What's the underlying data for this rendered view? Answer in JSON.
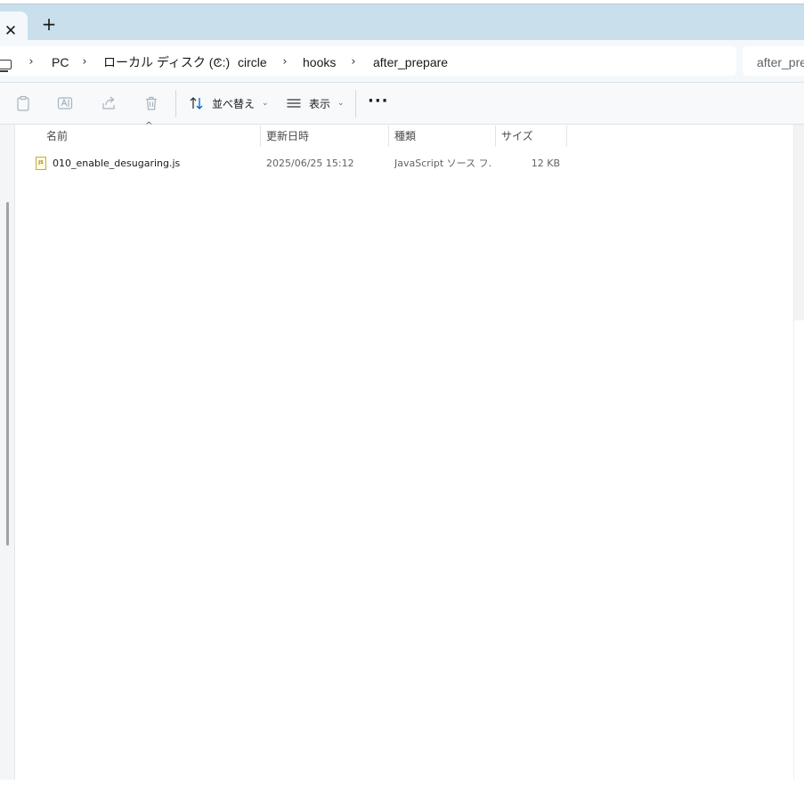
{
  "tabs": {
    "close_glyph": "✕",
    "new_tab_glyph": "+"
  },
  "breadcrumb": {
    "items": [
      "PC",
      "ローカル ディスク (C:)",
      "circle",
      "hooks",
      "after_prepare"
    ],
    "separator": "›"
  },
  "search": {
    "text": "after_pre"
  },
  "toolbar": {
    "sort_label": "並べ替え",
    "view_label": "表示",
    "more_glyph": "···"
  },
  "columns": {
    "name": "名前",
    "date": "更新日時",
    "type": "種類",
    "size": "サイズ"
  },
  "files": [
    {
      "name": "010_enable_desugaring.js",
      "date": "2025/06/25 15:12",
      "type": "JavaScript ソース フ...",
      "size": "12 KB",
      "icon_label": "JS"
    }
  ],
  "colors": {
    "tabstrip": "#c9e0ec",
    "addressbar": "#f4f8fb",
    "accent": "#0067c0"
  }
}
